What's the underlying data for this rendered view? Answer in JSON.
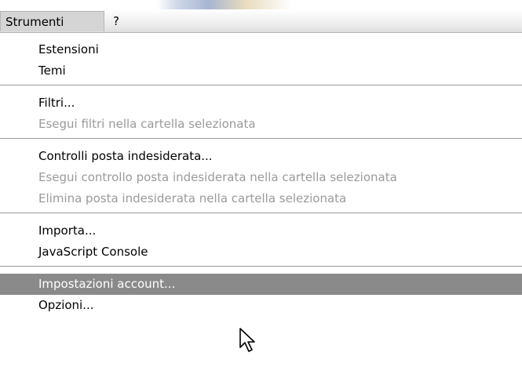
{
  "menubar": {
    "items": [
      {
        "label": "Strumenti"
      },
      {
        "label": "?"
      }
    ]
  },
  "menu": {
    "items": [
      {
        "label": "Estensioni",
        "enabled": true
      },
      {
        "label": "Temi",
        "enabled": true
      },
      {
        "label": "Filtri...",
        "enabled": true
      },
      {
        "label": "Esegui filtri nella cartella selezionata",
        "enabled": false
      },
      {
        "label": "Controlli posta indesiderata...",
        "enabled": true
      },
      {
        "label": "Esegui controllo posta indesiderata nella cartella selezionata",
        "enabled": false
      },
      {
        "label": "Elimina posta indesiderata nella cartella selezionata",
        "enabled": false
      },
      {
        "label": "Importa...",
        "enabled": true
      },
      {
        "label": "JavaScript Console",
        "enabled": true
      },
      {
        "label": "Impostazioni account...",
        "enabled": true,
        "highlighted": true
      },
      {
        "label": "Opzioni...",
        "enabled": true
      }
    ]
  },
  "colors": {
    "highlight": "#8a8a8a",
    "disabled_text": "#9a9a9a"
  }
}
